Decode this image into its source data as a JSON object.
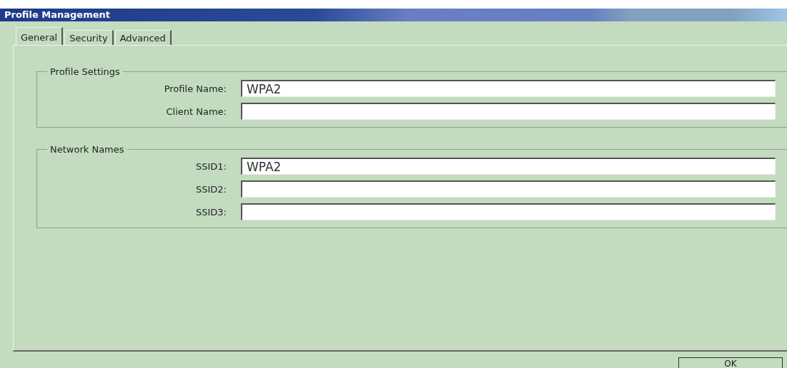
{
  "window": {
    "title": "Profile Management"
  },
  "tabs": [
    {
      "label": "General",
      "selected": true
    },
    {
      "label": "Security",
      "selected": false
    },
    {
      "label": "Advanced",
      "selected": false
    }
  ],
  "groups": [
    {
      "title": "Profile Settings",
      "fields": [
        {
          "label": "Profile Name:",
          "value": "WPA2"
        },
        {
          "label": "Client Name:"
        }
      ]
    },
    {
      "title": "Network Names",
      "fields": [
        {
          "label": "SSID1:",
          "value": "WPA2"
        },
        {
          "label": "SSID2:"
        },
        {
          "label": "SSID3:"
        }
      ]
    }
  ],
  "buttons": [
    "OK"
  ]
}
